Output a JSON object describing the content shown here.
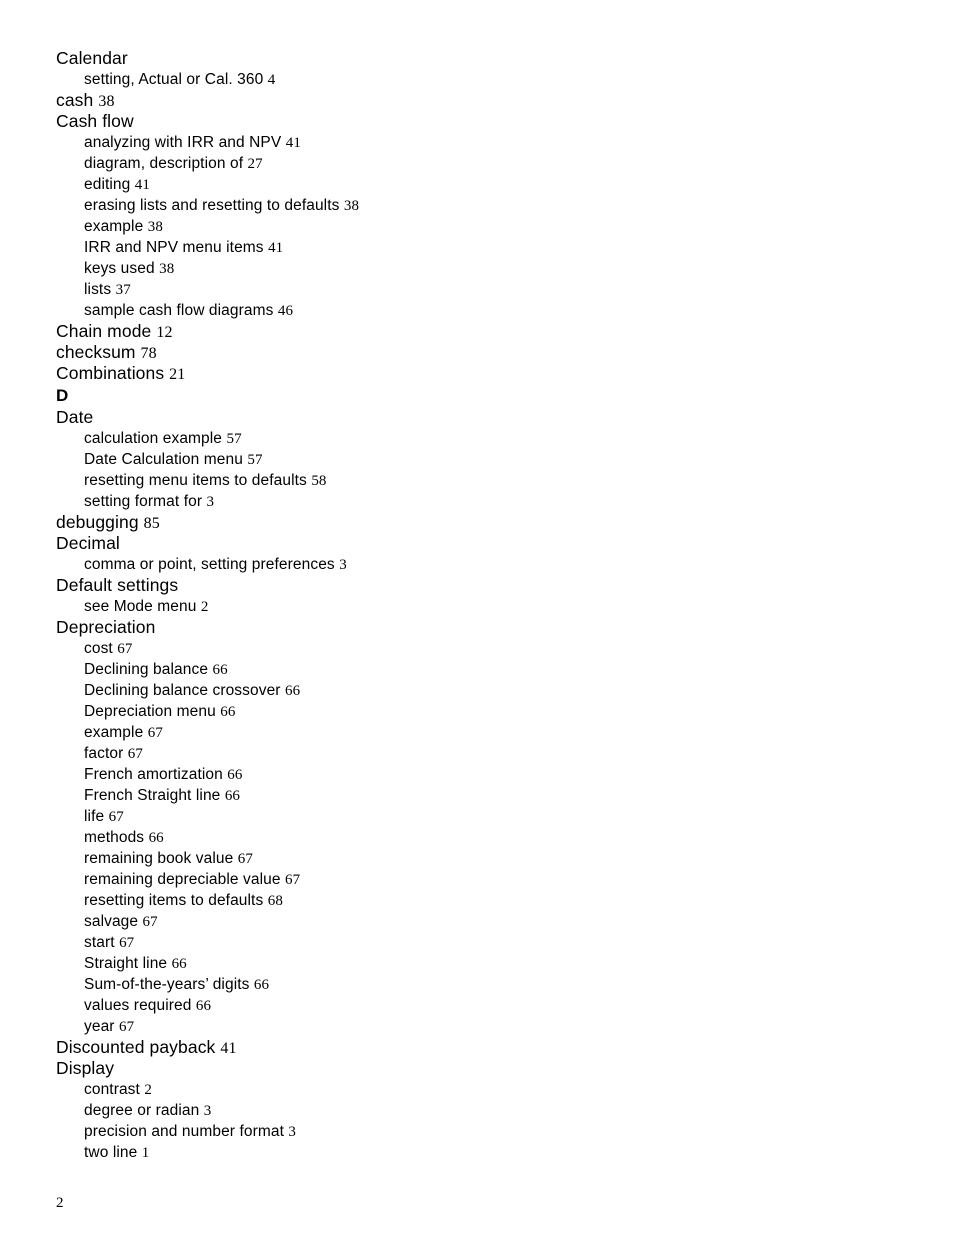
{
  "document": {
    "page_number": "2"
  },
  "index": {
    "entries": [
      {
        "level": "main",
        "text": "Calendar",
        "page": ""
      },
      {
        "level": "sub",
        "text": "setting, Actual or Cal. 360",
        "page": "4"
      },
      {
        "level": "main",
        "text": "cash",
        "page": "38"
      },
      {
        "level": "main",
        "text": "Cash flow",
        "page": ""
      },
      {
        "level": "sub",
        "text": "analyzing with IRR and NPV",
        "page": "41"
      },
      {
        "level": "sub",
        "text": "diagram, description of",
        "page": "27"
      },
      {
        "level": "sub",
        "text": "editing",
        "page": "41"
      },
      {
        "level": "sub",
        "text": "erasing lists and resetting to defaults",
        "page": "38"
      },
      {
        "level": "sub",
        "text": "example",
        "page": "38"
      },
      {
        "level": "sub",
        "text": "IRR and NPV menu items",
        "page": "41"
      },
      {
        "level": "sub",
        "text": "keys used",
        "page": "38"
      },
      {
        "level": "sub",
        "text": "lists",
        "page": "37"
      },
      {
        "level": "sub",
        "text": "sample cash flow diagrams",
        "page": "46"
      },
      {
        "level": "main",
        "text": "Chain mode",
        "page": "12"
      },
      {
        "level": "main",
        "text": "checksum",
        "page": "78"
      },
      {
        "level": "main",
        "text": "Combinations",
        "page": "21"
      },
      {
        "level": "section",
        "text": "D",
        "page": ""
      },
      {
        "level": "main",
        "text": "Date",
        "page": ""
      },
      {
        "level": "sub",
        "text": "calculation example",
        "page": "57"
      },
      {
        "level": "sub",
        "text": "Date Calculation menu",
        "page": "57"
      },
      {
        "level": "sub",
        "text": "resetting menu items to defaults",
        "page": "58"
      },
      {
        "level": "sub",
        "text": "setting format for",
        "page": "3"
      },
      {
        "level": "main",
        "text": "debugging",
        "page": "85"
      },
      {
        "level": "main",
        "text": "Decimal",
        "page": ""
      },
      {
        "level": "sub",
        "text": "comma or point, setting preferences",
        "page": "3"
      },
      {
        "level": "main",
        "text": "Default settings",
        "page": ""
      },
      {
        "level": "sub",
        "text": "see Mode menu",
        "page": "2"
      },
      {
        "level": "main",
        "text": "Depreciation",
        "page": ""
      },
      {
        "level": "sub",
        "text": "cost",
        "page": "67"
      },
      {
        "level": "sub",
        "text": "Declining balance",
        "page": "66"
      },
      {
        "level": "sub",
        "text": "Declining balance crossover",
        "page": "66"
      },
      {
        "level": "sub",
        "text": "Depreciation menu",
        "page": "66"
      },
      {
        "level": "sub",
        "text": "example",
        "page": "67"
      },
      {
        "level": "sub",
        "text": "factor",
        "page": "67"
      },
      {
        "level": "sub",
        "text": "French amortization",
        "page": "66"
      },
      {
        "level": "sub",
        "text": "French Straight line",
        "page": "66"
      },
      {
        "level": "sub",
        "text": "life",
        "page": "67"
      },
      {
        "level": "sub",
        "text": "methods",
        "page": "66"
      },
      {
        "level": "sub",
        "text": "remaining book value",
        "page": "67"
      },
      {
        "level": "sub",
        "text": "remaining depreciable value",
        "page": "67"
      },
      {
        "level": "sub",
        "text": "resetting items to defaults",
        "page": "68"
      },
      {
        "level": "sub",
        "text": "salvage",
        "page": "67"
      },
      {
        "level": "sub",
        "text": "start",
        "page": "67"
      },
      {
        "level": "sub",
        "text": "Straight line",
        "page": "66"
      },
      {
        "level": "sub",
        "text": "Sum-of-the-years’ digits",
        "page": "66"
      },
      {
        "level": "sub",
        "text": "values required",
        "page": "66"
      },
      {
        "level": "sub",
        "text": "year",
        "page": "67"
      },
      {
        "level": "main",
        "text": "Discounted payback",
        "page": "41"
      },
      {
        "level": "main",
        "text": "Display",
        "page": ""
      },
      {
        "level": "sub",
        "text": "contrast",
        "page": "2"
      },
      {
        "level": "sub",
        "text": "degree or radian",
        "page": "3"
      },
      {
        "level": "sub",
        "text": "precision and number format",
        "page": "3"
      },
      {
        "level": "sub",
        "text": "two line",
        "page": "1"
      }
    ]
  }
}
